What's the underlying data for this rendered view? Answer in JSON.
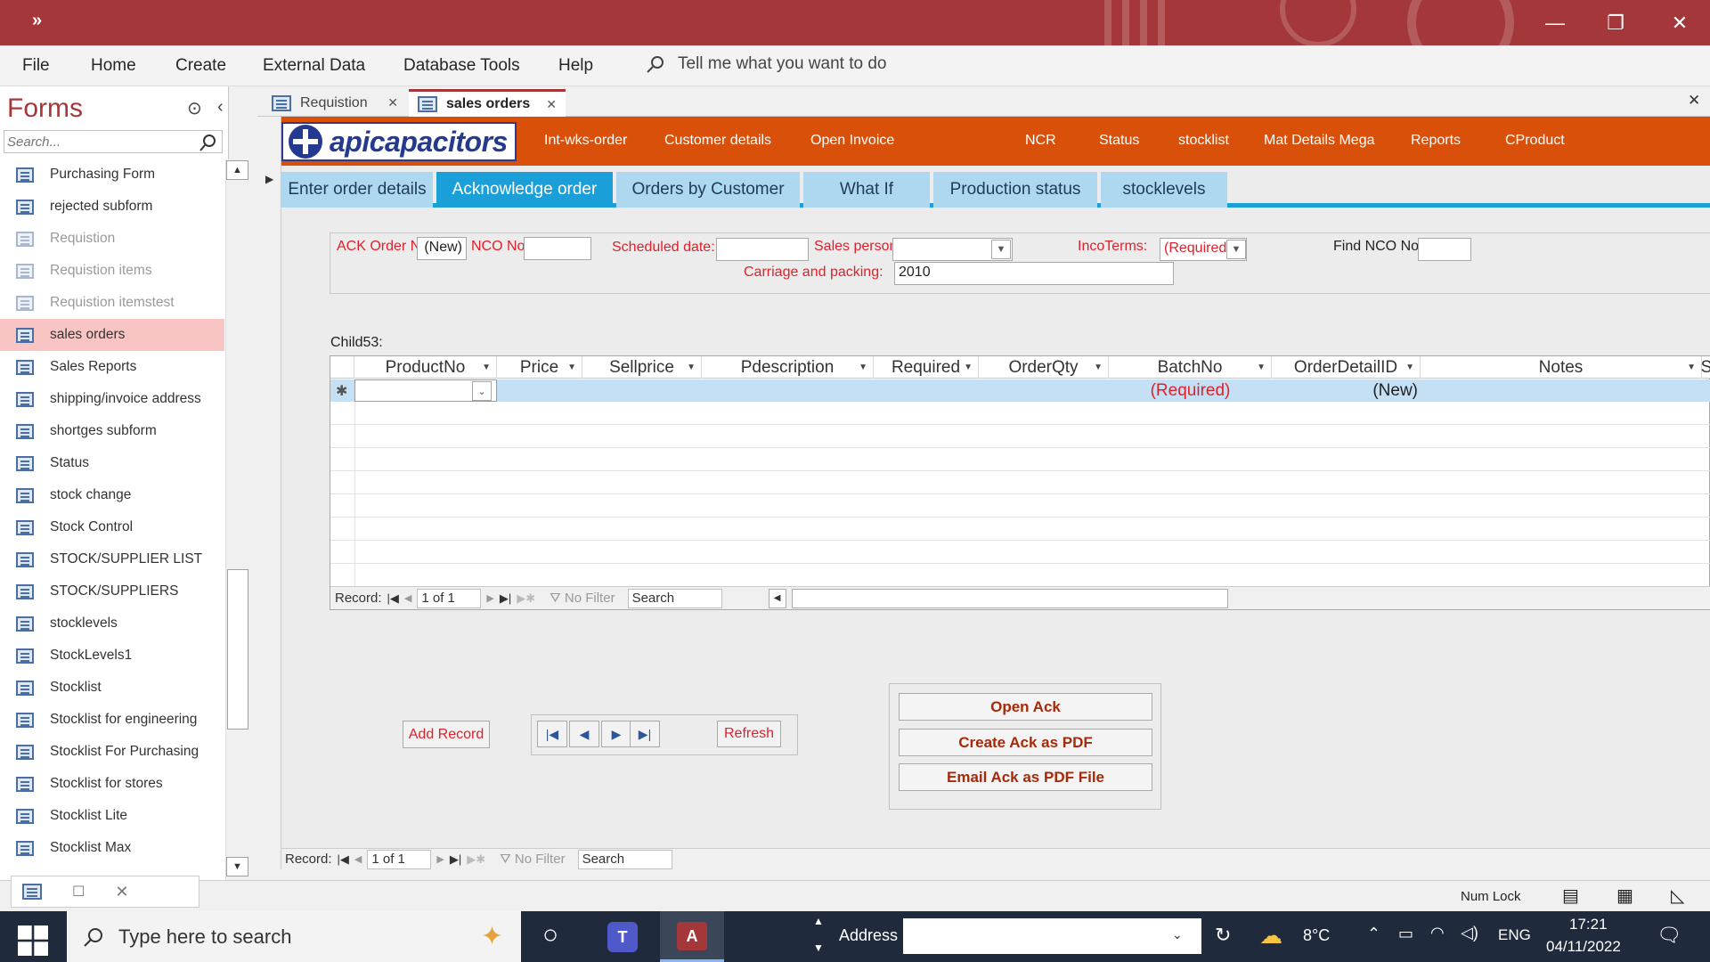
{
  "window": {
    "quick_access_glyph": "»",
    "minimize": "—",
    "restore": "❐",
    "close": "✕"
  },
  "menu": {
    "items": [
      "File",
      "Home",
      "Create",
      "External Data",
      "Database Tools",
      "Help"
    ],
    "tell_me": "Tell me what you want to do"
  },
  "nav": {
    "title": "Forms",
    "search_placeholder": "Search...",
    "items": [
      {
        "label": "Purchasing Form",
        "state": "normal"
      },
      {
        "label": "rejected subform",
        "state": "normal"
      },
      {
        "label": "Requistion",
        "state": "dim"
      },
      {
        "label": "Requistion items",
        "state": "dim"
      },
      {
        "label": "Requistion itemstest",
        "state": "dim"
      },
      {
        "label": "sales orders",
        "state": "selected"
      },
      {
        "label": "Sales Reports",
        "state": "normal"
      },
      {
        "label": "shipping/invoice address",
        "state": "normal"
      },
      {
        "label": "shortges subform",
        "state": "normal"
      },
      {
        "label": "Status",
        "state": "normal"
      },
      {
        "label": "stock change",
        "state": "normal"
      },
      {
        "label": "Stock Control",
        "state": "normal"
      },
      {
        "label": "STOCK/SUPPLIER LIST",
        "state": "normal"
      },
      {
        "label": "STOCK/SUPPLIERS",
        "state": "normal"
      },
      {
        "label": "stocklevels",
        "state": "normal"
      },
      {
        "label": "StockLevels1",
        "state": "normal"
      },
      {
        "label": "Stocklist",
        "state": "normal"
      },
      {
        "label": "Stocklist for engineering",
        "state": "normal"
      },
      {
        "label": "Stocklist For Purchasing",
        "state": "normal"
      },
      {
        "label": "Stocklist for stores",
        "state": "normal"
      },
      {
        "label": "Stocklist Lite",
        "state": "normal"
      },
      {
        "label": "Stocklist Max",
        "state": "normal"
      }
    ]
  },
  "doc_tabs": [
    {
      "label": "Requistion",
      "active": false
    },
    {
      "label": "sales orders",
      "active": true
    }
  ],
  "header": {
    "logo_text": "apicapacitors",
    "links": [
      "Int-wks-order",
      "Customer details",
      "Open Invoice",
      "NCR",
      "Status",
      "stocklist",
      "Mat Details Mega",
      "Reports",
      "CProduct"
    ]
  },
  "form_tabs": [
    {
      "label": "Enter order details",
      "active": false
    },
    {
      "label": "Acknowledge order",
      "active": true
    },
    {
      "label": "Orders by Customer",
      "active": false
    },
    {
      "label": "What If",
      "active": false
    },
    {
      "label": "Production status",
      "active": false
    },
    {
      "label": "stocklevels",
      "active": false
    }
  ],
  "details": {
    "ack_order_label": "ACK Order No",
    "ack_order_value": "(New)",
    "nco_label": "NCO No",
    "nco_value": "",
    "scheduled_label": "Scheduled date:",
    "scheduled_value": "",
    "sales_person_label": "Sales person",
    "sales_person_value": "",
    "incoterms_label": "IncoTerms:",
    "incoterms_value": "(Required)",
    "find_nco_label": "Find NCO No",
    "carriage_label": "Carriage  and packing:",
    "carriage_value": "2010"
  },
  "subform": {
    "label": "Child53:",
    "columns": [
      "ProductNo",
      "Price",
      "Sellprice",
      "Pdescription",
      "Required",
      "OrderQty",
      "BatchNo",
      "OrderDetailID",
      "Notes",
      "S"
    ],
    "new_row": {
      "BatchNo": "(Required)",
      "OrderDetailID": "(New)",
      "marker": "✱"
    },
    "nav": {
      "record_label": "Record:",
      "position": "1 of 1",
      "filter": "No Filter",
      "search": "Search"
    }
  },
  "buttons": {
    "add_record": "Add Record",
    "refresh": "Refresh",
    "open_ack": "Open Ack",
    "create_pdf": "Create Ack as PDF",
    "email_pdf": "Email Ack as PDF File"
  },
  "main_nav": {
    "record_label": "Record:",
    "position": "1 of 1",
    "filter": "No Filter",
    "search": "Search"
  },
  "status": {
    "num_lock": "Num Lock"
  },
  "taskbar": {
    "search_placeholder": "Type here to search",
    "address_label": "Address",
    "temperature": "8°C",
    "language": "ENG",
    "time": "17:21",
    "date": "04/11/2022"
  }
}
